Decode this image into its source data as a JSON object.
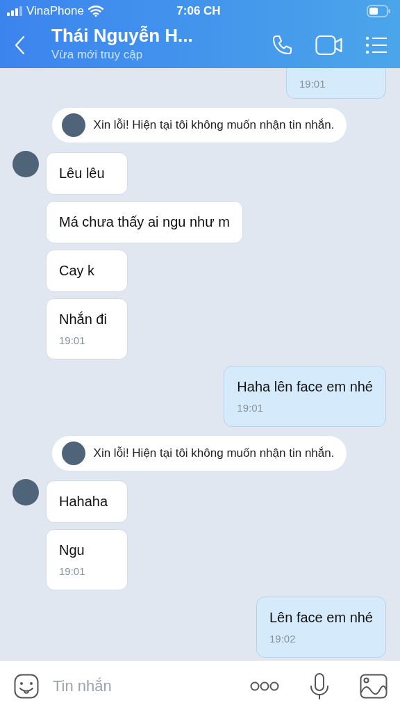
{
  "status_bar": {
    "carrier": "VinaPhone",
    "time": "7:06 CH"
  },
  "header": {
    "title": "Thái Nguyễn H...",
    "subtitle": "Vừa mới truy cập"
  },
  "messages": [
    {
      "kind": "out",
      "time": "19:01",
      "partial": true
    },
    {
      "kind": "notice",
      "text": "Xin lỗi! Hiện tại tôi không muốn nhận tin nhắn."
    },
    {
      "kind": "in",
      "text": "Lêu lêu",
      "avatar": true
    },
    {
      "kind": "in",
      "text": "Má chưa thấy ai ngu như m",
      "avatar": false
    },
    {
      "kind": "in",
      "text": "Cay k",
      "avatar": false
    },
    {
      "kind": "in",
      "text": "Nhắn đi",
      "time": "19:01",
      "avatar": false
    },
    {
      "kind": "out",
      "text": "Haha lên face em nhé",
      "time": "19:01"
    },
    {
      "kind": "notice",
      "text": "Xin lỗi! Hiện tại tôi không muốn nhận tin nhắn."
    },
    {
      "kind": "in",
      "text": "Hahaha",
      "avatar": true
    },
    {
      "kind": "in",
      "text": "Ngu",
      "time": "19:01",
      "avatar": false
    },
    {
      "kind": "out",
      "text": "Lên face em nhé",
      "time": "19:02"
    }
  ],
  "composer": {
    "placeholder": "Tin nhắn"
  }
}
